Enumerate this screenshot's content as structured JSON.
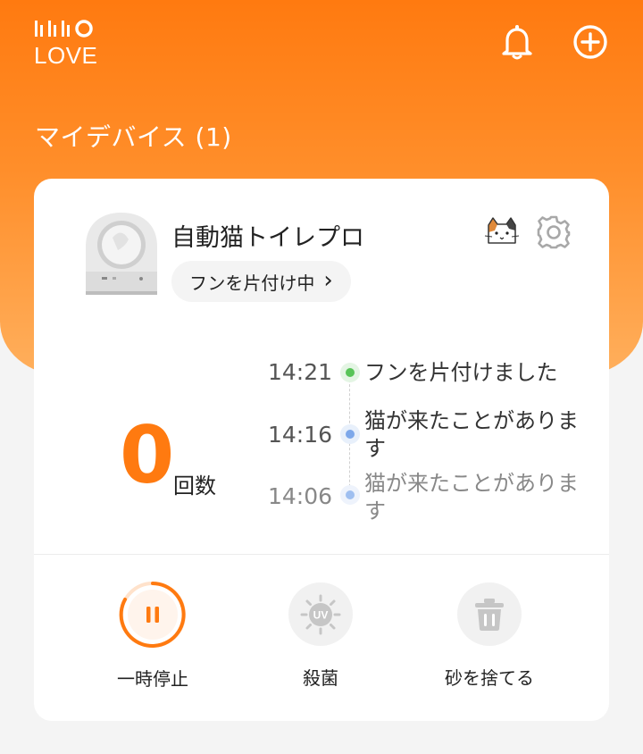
{
  "header": {
    "logo_text": "LOVE",
    "bell_icon": "bell-icon",
    "add_icon": "plus-circle-icon"
  },
  "section": {
    "title": "マイデバイス (1)"
  },
  "device": {
    "name": "自動猫トイレプロ",
    "status": "フンを片付け中",
    "status_chevron": "›",
    "count_value": "0",
    "count_unit": "回数"
  },
  "timeline": [
    {
      "time": "14:21",
      "event": "フンを片付けました",
      "color": "#58c458",
      "ring": "#e4f5e4"
    },
    {
      "time": "14:16",
      "event": "猫が来たことがあります",
      "color": "#7ea8ea",
      "ring": "#e8f0fb"
    },
    {
      "time": "14:06",
      "event": "猫が来たことがあります",
      "color": "#9fbff0",
      "ring": "#eef3fc"
    }
  ],
  "actions": {
    "pause_label": "一時停止",
    "uv_label": "殺菌",
    "uv_badge": "UV",
    "discard_label": "砂を捨てる"
  },
  "colors": {
    "accent": "#ff7a10",
    "card": "#ffffff",
    "background": "#f4f4f4"
  }
}
